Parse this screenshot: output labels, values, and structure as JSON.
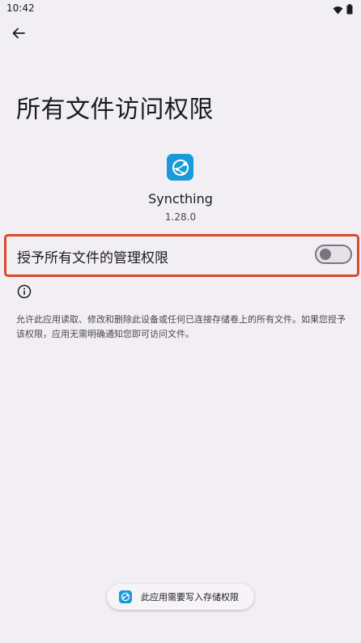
{
  "status_bar": {
    "time": "10:42",
    "icons": [
      "wifi-icon",
      "battery-icon"
    ]
  },
  "header": {
    "back_icon": "arrow-back-icon"
  },
  "page": {
    "title": "所有文件访问权限"
  },
  "app": {
    "icon": "syncthing-logo-icon",
    "name": "Syncthing",
    "version": "1.28.0"
  },
  "permission": {
    "label": "授予所有文件的管理权限",
    "enabled": false
  },
  "info": {
    "icon": "info-icon",
    "description": "允许此应用读取、修改和删除此设备或任何已连接存储卷上的所有文件。如果您授予该权限，应用无需明确通知您即可访问文件。"
  },
  "toast": {
    "icon": "syncthing-logo-icon",
    "text": "此应用需要写入存储权限"
  },
  "colors": {
    "background": "#f2eff4",
    "accent": "#1a9ad8",
    "highlight_border": "#d9492b",
    "toggle_off": "#79747e"
  }
}
